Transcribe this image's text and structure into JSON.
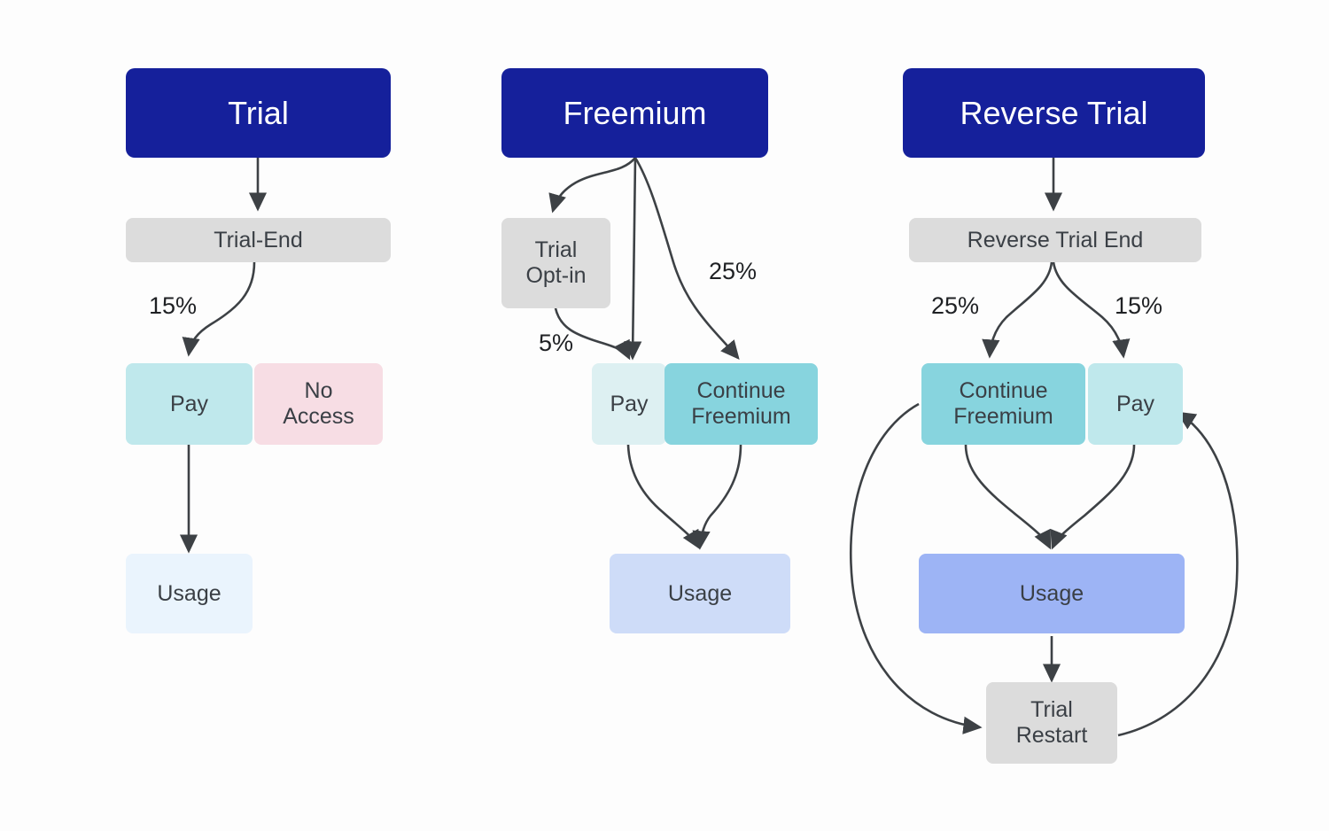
{
  "diagram": {
    "title": "Monetization model flows: Trial, Freemium, Reverse Trial",
    "background": "#fdfdfd",
    "edge_color": "#3d4145",
    "colors": {
      "header_blue": "#15209b",
      "gray": "#dcdcdc",
      "pay_strong": "#bfe8ec",
      "pay_light": "#ddf0f2",
      "pay_mid": "#c5e9ef",
      "no_access_pink": "#f7dde4",
      "continue_freemium": "#87d4de",
      "usage_faint": "#eaf4fd",
      "usage_soft": "#cedcf8",
      "usage_strong": "#9db4f5",
      "text_dark": "#3a3f45"
    }
  },
  "columns": [
    {
      "key": "trial",
      "header": "Trial",
      "nodes": [
        {
          "id": "trial-end",
          "label": "Trial-End"
        },
        {
          "id": "pay",
          "label": "Pay"
        },
        {
          "id": "no-access",
          "label": "No\nAccess"
        },
        {
          "id": "usage",
          "label": "Usage"
        }
      ],
      "edge_labels": [
        {
          "id": "trial-end-to-pay",
          "text": "15%"
        }
      ]
    },
    {
      "key": "freemium",
      "header": "Freemium",
      "nodes": [
        {
          "id": "trial-opt-in",
          "label": "Trial\nOpt-in"
        },
        {
          "id": "pay",
          "label": "Pay"
        },
        {
          "id": "continue-freemium",
          "label": "Continue\nFreemium"
        },
        {
          "id": "usage",
          "label": "Usage"
        }
      ],
      "edge_labels": [
        {
          "id": "freemium-to-continue-freemium",
          "text": "25%"
        },
        {
          "id": "trial-opt-in-to-pay",
          "text": "5%"
        }
      ]
    },
    {
      "key": "reverse-trial",
      "header": "Reverse Trial",
      "nodes": [
        {
          "id": "reverse-trial-end",
          "label": "Reverse Trial End"
        },
        {
          "id": "continue-freemium",
          "label": "Continue\nFreemium"
        },
        {
          "id": "pay",
          "label": "Pay"
        },
        {
          "id": "usage",
          "label": "Usage"
        },
        {
          "id": "trial-restart",
          "label": "Trial\nRestart"
        }
      ],
      "edge_labels": [
        {
          "id": "rte-to-continue-freemium",
          "text": "25%"
        },
        {
          "id": "rte-to-pay",
          "text": "15%"
        }
      ]
    }
  ],
  "chart_data": {
    "type": "diagram",
    "title": "Trial / Freemium / Reverse Trial conversion flows",
    "flows": [
      {
        "column": "Trial",
        "from": "Trial",
        "to": "Trial-End",
        "rate": null
      },
      {
        "column": "Trial",
        "from": "Trial-End",
        "to": "Pay",
        "rate": "15%"
      },
      {
        "column": "Trial",
        "from": "Trial-End",
        "to": "No Access",
        "rate": null
      },
      {
        "column": "Trial",
        "from": "Pay",
        "to": "Usage",
        "rate": null
      },
      {
        "column": "Freemium",
        "from": "Freemium",
        "to": "Trial Opt-in",
        "rate": null
      },
      {
        "column": "Freemium",
        "from": "Freemium",
        "to": "Pay",
        "rate": null
      },
      {
        "column": "Freemium",
        "from": "Freemium",
        "to": "Continue Freemium",
        "rate": "25%"
      },
      {
        "column": "Freemium",
        "from": "Trial Opt-in",
        "to": "Pay",
        "rate": "5%"
      },
      {
        "column": "Freemium",
        "from": "Pay",
        "to": "Usage",
        "rate": null
      },
      {
        "column": "Freemium",
        "from": "Continue Freemium",
        "to": "Usage",
        "rate": null
      },
      {
        "column": "Reverse Trial",
        "from": "Reverse Trial",
        "to": "Reverse Trial End",
        "rate": null
      },
      {
        "column": "Reverse Trial",
        "from": "Reverse Trial End",
        "to": "Continue Freemium",
        "rate": "25%"
      },
      {
        "column": "Reverse Trial",
        "from": "Reverse Trial End",
        "to": "Pay",
        "rate": "15%"
      },
      {
        "column": "Reverse Trial",
        "from": "Continue Freemium",
        "to": "Usage",
        "rate": null
      },
      {
        "column": "Reverse Trial",
        "from": "Pay",
        "to": "Usage",
        "rate": null
      },
      {
        "column": "Reverse Trial",
        "from": "Usage",
        "to": "Trial Restart",
        "rate": null
      },
      {
        "column": "Reverse Trial",
        "from": "Continue Freemium",
        "to": "Trial Restart",
        "rate": null
      },
      {
        "column": "Reverse Trial",
        "from": "Trial Restart",
        "to": "Pay",
        "rate": null
      }
    ]
  }
}
